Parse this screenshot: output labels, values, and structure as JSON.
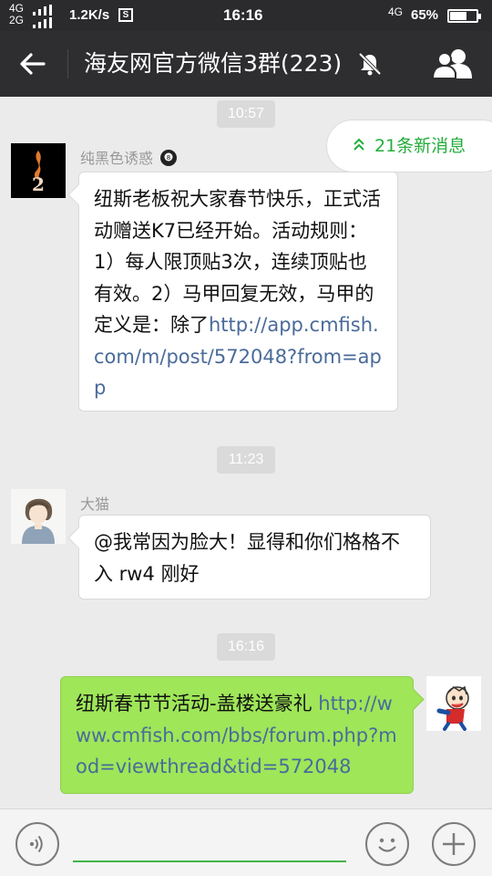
{
  "status_bar": {
    "network_top": "4G",
    "network_bottom": "2G",
    "speed": "1.2K/s",
    "s_icon": "S",
    "time": "16:16",
    "net_type": "4G",
    "battery_text": "65%",
    "battery_level": 0.65
  },
  "header": {
    "title": "海友网官方微信3群(223)",
    "icons": [
      "back-arrow-icon",
      "mute-bell-icon",
      "group-members-icon"
    ]
  },
  "new_messages": {
    "label": "21条新消息",
    "icon": "double-chevron-up-icon"
  },
  "messages": [
    {
      "type": "time",
      "text": "10:57"
    },
    {
      "type": "incoming",
      "sender": "纯黑色诱惑",
      "sender_icon": "8-ball-icon",
      "text": "纽斯老板祝大家春节快乐，正式活动赠送K7已经开始。活动规则：1）每人限顶贴3次，连续顶贴也有效。2）马甲回复无效，马甲的定义是：除了",
      "link": "http://app.cmfish.com/m/post/572048?from=app"
    },
    {
      "type": "time",
      "text": "11:23"
    },
    {
      "type": "incoming",
      "sender": "大猫",
      "text": "@我常因为脸大！显得和你们格格不入 rw4 刚好"
    },
    {
      "type": "time",
      "text": "16:16"
    },
    {
      "type": "outgoing",
      "text": "纽斯春节节活动-盖楼送豪礼 ",
      "link": "http://www.cmfish.com/bbs/forum.php?mod=viewthread&tid=572048"
    }
  ],
  "input_bar": {
    "icons": [
      "voice-icon",
      "emoji-icon",
      "plus-icon"
    ]
  },
  "colors": {
    "accent_green": "#23ad3a",
    "outgoing_bubble": "#9fe659",
    "link": "#4a6b9a",
    "titlebar": "#2e2e30"
  }
}
